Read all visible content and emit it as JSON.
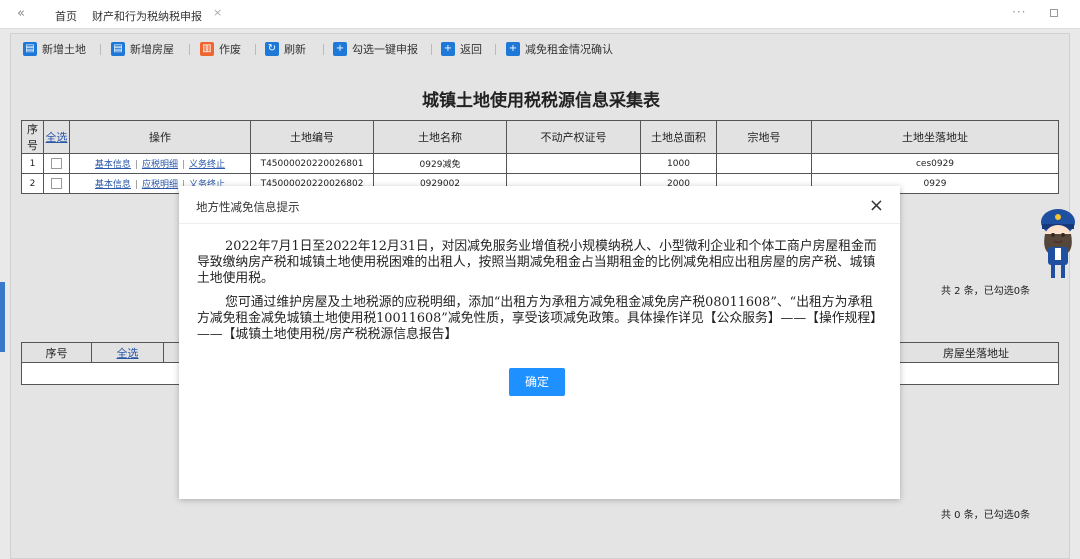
{
  "tabs": {
    "collapse_symbol": "«",
    "home_label": "首页",
    "active_label": "财产和行为税纳税申报",
    "close_symbol": "×",
    "more_symbol": "···"
  },
  "toolbar": {
    "buttons": [
      {
        "label": "新增土地",
        "icon": "document-icon",
        "color": "#1e78d7"
      },
      {
        "label": "新增房屋",
        "icon": "document-icon",
        "color": "#1e78d7"
      },
      {
        "label": "作废",
        "icon": "trash-icon",
        "color": "#f0652f"
      },
      {
        "label": "刷新",
        "icon": "refresh-icon",
        "color": "#1e78d7"
      },
      {
        "label": "勾选一键申报",
        "icon": "plus-icon",
        "color": "#1e78d7"
      },
      {
        "label": "返回",
        "icon": "plus-icon",
        "color": "#1e78d7"
      },
      {
        "label": "减免租金情况确认",
        "icon": "plus-icon",
        "color": "#1e78d7"
      }
    ]
  },
  "land_form": {
    "title": "城镇土地使用税税源信息采集表",
    "headers": [
      "序号",
      "全选",
      "操作",
      "土地编号",
      "土地名称",
      "不动产权证号",
      "土地总面积",
      "宗地号",
      "土地坐落地址"
    ],
    "rows": [
      {
        "no": "1",
        "ops": [
          "基本信息",
          "应税明细",
          "义务终止"
        ],
        "land_id": "T45000020220026801",
        "land_name": "0929减免",
        "cert_no": "",
        "area": "1000",
        "parcel_no": "",
        "address": "ces0929"
      },
      {
        "no": "2",
        "ops": [
          "基本信息",
          "应税明细",
          "义务终止"
        ],
        "land_id": "T45000020220026802",
        "land_name": "0929002",
        "cert_no": "",
        "area": "2000",
        "parcel_no": "",
        "address": "0929"
      }
    ],
    "count_text": "共 2 条，已勾选0条"
  },
  "house_form": {
    "headers": [
      "序号",
      "全选",
      "房屋坐落地址"
    ],
    "count_text": "共 0 条，已勾选0条"
  },
  "modal": {
    "title": "地方性减免信息提示",
    "close_symbol": "×",
    "paragraph1": "2022年7月1日至2022年12月31日，对因减免服务业增值税小规模纳税人、小型微利企业和个体工商户房屋租金而导致缴纳房产税和城镇土地使用税困难的出租人，按照当期减免租金占当期租金的比例减免相应出租房屋的房产税、城镇土地使用税。",
    "paragraph2": "您可通过维护房屋及土地税源的应税明细，添加“出租方为承租方减免租金减免房产税08011608”、“出租方为承租方减免租金减免城镇土地使用税10011608”减免性质，享受该项减免政策。具体操作详见【公众服务】——【操作规程】——【城镇土地使用税/房产税税源信息报告】",
    "ok_label": "确定"
  },
  "colors": {
    "accent": "#1e90ff",
    "link": "#2a57a8",
    "danger": "#f0652f"
  }
}
